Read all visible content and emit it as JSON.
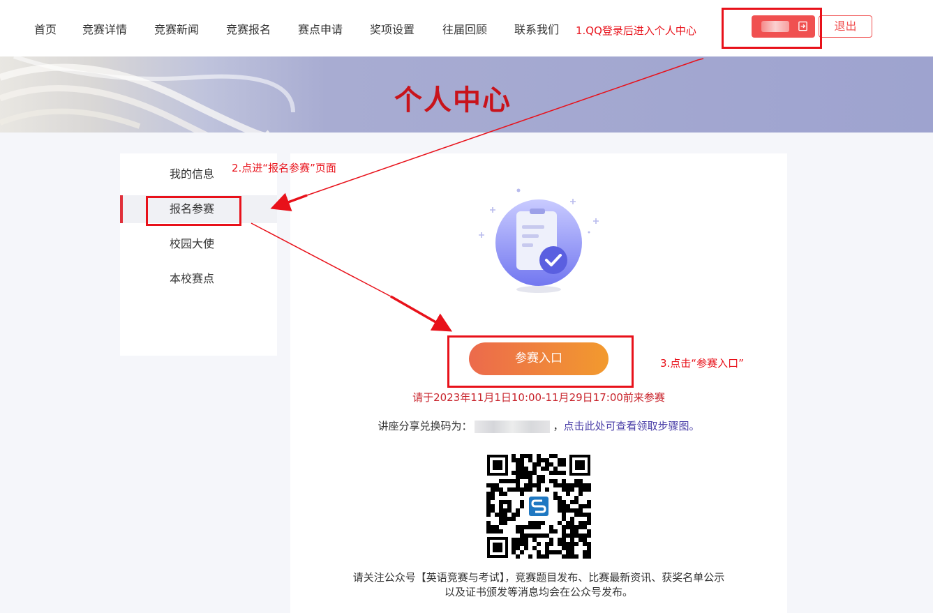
{
  "nav": {
    "items": [
      "首页",
      "竞赛详情",
      "竞赛新闻",
      "竞赛报名",
      "赛点申请",
      "奖项设置",
      "往届回顾",
      "联系我们"
    ],
    "logout_label": "退出"
  },
  "banner": {
    "title": "个人中心"
  },
  "sidebar": {
    "items": [
      {
        "label": "我的信息"
      },
      {
        "label": "报名参赛"
      },
      {
        "label": "校园大使"
      },
      {
        "label": "本校赛点"
      }
    ],
    "active_item": "报名参赛"
  },
  "main": {
    "enter_button_label": "参赛入口",
    "time_note": "请于2023年11月1日10:00-11月29日17:00前来参赛",
    "code_prefix": "讲座分享兑换码为：",
    "code_separator": "，",
    "code_link": "点击此处可查看领取步骤图。",
    "follow_note_line1": "请关注公众号【英语竞赛与考试】，竞赛题目发布、比赛最新资讯、获奖名单公示",
    "follow_note_line2": "以及证书颁发等消息均会在公众号发布。"
  },
  "annotations": {
    "step1": "1.QQ登录后进入个人中心",
    "step2": "2.点进“报名参赛”页面",
    "step3": "3.点击“参赛入口”"
  },
  "colors": {
    "accent_red": "#e8111a",
    "button_gradient_start": "#ec6a4c",
    "button_gradient_end": "#f29a2e",
    "link_purple": "#4b3fa8"
  }
}
